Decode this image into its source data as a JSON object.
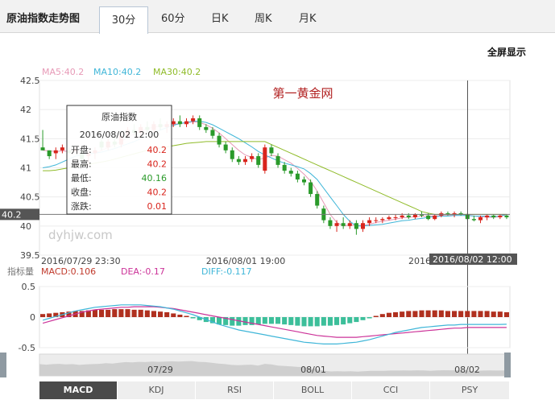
{
  "header": {
    "title": "原油指数走势图",
    "tabs": [
      {
        "label": "30分",
        "active": true
      },
      {
        "label": "60分",
        "active": false
      },
      {
        "label": "日K",
        "active": false
      },
      {
        "label": "周K",
        "active": false
      },
      {
        "label": "月K",
        "active": false
      }
    ],
    "fullscreen_label": "全屏显示"
  },
  "chart_data": {
    "type": "candlestick",
    "ma_legend": [
      {
        "name": "MA5:40.2",
        "color": "#e79ab7"
      },
      {
        "name": "MA10:40.2",
        "color": "#3fb6d8"
      },
      {
        "name": "MA30:40.2",
        "color": "#8fbb28"
      }
    ],
    "watermark_title": "第一黄金网",
    "watermark_site": "dyhjw.com",
    "ylim": [
      39.5,
      42.5
    ],
    "yticks": [
      "42.5",
      "42",
      "41.5",
      "41",
      "40.5",
      "40",
      "39.5"
    ],
    "ytick_values": [
      42.5,
      42,
      41.5,
      41,
      40.5,
      40,
      39.5
    ],
    "current_price": "40.2",
    "current_value": 40.2,
    "xtick_labels": [
      "2016/07/29 23:30",
      "2016/08/01 19:00",
      "2016/"
    ],
    "crosshair_label": "2016/08/02 12:00",
    "up_color": "#d9251d",
    "down_color": "#2a9a2a",
    "candles": [
      [
        41.35,
        41.65,
        41.3,
        41.3
      ],
      [
        41.3,
        41.3,
        41.15,
        41.2
      ],
      [
        41.25,
        41.35,
        41.15,
        41.3
      ],
      [
        41.3,
        41.4,
        41.25,
        41.35
      ],
      [
        41.3,
        41.35,
        41.25,
        41.25
      ],
      [
        41.3,
        41.35,
        41.25,
        41.3
      ],
      [
        41.25,
        41.3,
        41.1,
        41.15
      ],
      [
        41.2,
        41.3,
        41.0,
        41.25
      ],
      [
        41.25,
        41.35,
        41.15,
        41.3
      ],
      [
        41.45,
        41.5,
        41.3,
        41.35
      ],
      [
        41.35,
        41.5,
        41.3,
        41.45
      ],
      [
        41.45,
        41.55,
        41.35,
        41.4
      ],
      [
        41.4,
        41.6,
        41.35,
        41.55
      ],
      [
        41.55,
        41.7,
        41.5,
        41.65
      ],
      [
        41.65,
        41.75,
        41.55,
        41.6
      ],
      [
        41.6,
        41.75,
        41.55,
        41.7
      ],
      [
        41.7,
        41.8,
        41.6,
        41.65
      ],
      [
        41.65,
        41.8,
        41.6,
        41.75
      ],
      [
        41.75,
        41.85,
        41.65,
        41.7
      ],
      [
        41.7,
        41.8,
        41.6,
        41.75
      ],
      [
        41.75,
        41.85,
        41.7,
        41.8
      ],
      [
        41.8,
        41.9,
        41.7,
        41.75
      ],
      [
        41.75,
        41.85,
        41.7,
        41.8
      ],
      [
        41.8,
        41.9,
        41.75,
        41.85
      ],
      [
        41.85,
        41.9,
        41.65,
        41.7
      ],
      [
        41.7,
        41.75,
        41.6,
        41.65
      ],
      [
        41.65,
        41.7,
        41.5,
        41.55
      ],
      [
        41.55,
        41.6,
        41.35,
        41.4
      ],
      [
        41.4,
        41.45,
        41.25,
        41.3
      ],
      [
        41.3,
        41.35,
        41.1,
        41.15
      ],
      [
        41.15,
        41.2,
        41.05,
        41.1
      ],
      [
        41.1,
        41.2,
        41.05,
        41.15
      ],
      [
        41.15,
        41.25,
        41.1,
        41.2
      ],
      [
        41.2,
        41.25,
        41.0,
        41.05
      ],
      [
        40.95,
        41.4,
        40.9,
        41.35
      ],
      [
        41.35,
        41.4,
        41.2,
        41.25
      ],
      [
        41.2,
        41.25,
        41.0,
        41.05
      ],
      [
        41.05,
        41.1,
        40.9,
        40.95
      ],
      [
        40.95,
        41.0,
        40.85,
        40.9
      ],
      [
        40.9,
        40.95,
        40.75,
        40.8
      ],
      [
        40.8,
        40.85,
        40.7,
        40.75
      ],
      [
        40.75,
        40.8,
        40.5,
        40.55
      ],
      [
        40.55,
        40.6,
        40.3,
        40.35
      ],
      [
        40.3,
        40.35,
        40.05,
        40.1
      ],
      [
        40.1,
        40.15,
        39.95,
        40.0
      ],
      [
        40.0,
        40.1,
        39.9,
        40.05
      ],
      [
        40.05,
        40.15,
        39.95,
        40.0
      ],
      [
        40.0,
        40.1,
        39.95,
        40.05
      ],
      [
        40.05,
        40.1,
        39.85,
        39.95
      ],
      [
        39.95,
        40.1,
        39.9,
        40.05
      ],
      [
        40.05,
        40.15,
        40.0,
        40.1
      ],
      [
        40.1,
        40.15,
        40.05,
        40.1
      ],
      [
        40.1,
        40.15,
        40.05,
        40.12
      ],
      [
        40.12,
        40.18,
        40.1,
        40.15
      ],
      [
        40.15,
        40.2,
        40.1,
        40.15
      ],
      [
        40.15,
        40.22,
        40.12,
        40.18
      ],
      [
        40.18,
        40.22,
        40.12,
        40.15
      ],
      [
        40.15,
        40.22,
        40.12,
        40.2
      ],
      [
        40.2,
        40.25,
        40.15,
        40.18
      ],
      [
        40.18,
        40.22,
        40.1,
        40.12
      ],
      [
        40.12,
        40.2,
        40.1,
        40.18
      ],
      [
        40.18,
        40.25,
        40.15,
        40.22
      ],
      [
        40.22,
        40.25,
        40.18,
        40.2
      ],
      [
        40.2,
        40.25,
        40.15,
        40.22
      ],
      [
        40.22,
        40.25,
        40.18,
        40.2
      ],
      [
        40.2,
        40.22,
        40.1,
        40.12
      ],
      [
        40.12,
        40.18,
        40.08,
        40.1
      ],
      [
        40.1,
        40.18,
        40.05,
        40.15
      ],
      [
        40.15,
        40.2,
        40.1,
        40.18
      ],
      [
        40.18,
        40.2,
        40.12,
        40.15
      ],
      [
        40.15,
        40.2,
        40.12,
        40.18
      ],
      [
        40.18,
        40.2,
        40.12,
        40.15
      ]
    ],
    "ma5": [
      41.3,
      41.29,
      41.28,
      41.29,
      41.28,
      41.27,
      41.25,
      41.24,
      41.25,
      41.3,
      41.35,
      41.4,
      41.45,
      41.52,
      41.58,
      41.63,
      41.67,
      41.7,
      41.72,
      41.73,
      41.75,
      41.76,
      41.77,
      41.79,
      41.78,
      41.74,
      41.68,
      41.6,
      41.5,
      41.4,
      41.3,
      41.22,
      41.18,
      41.14,
      41.17,
      41.21,
      41.2,
      41.14,
      41.08,
      40.99,
      40.89,
      40.77,
      40.6,
      40.4,
      40.2,
      40.06,
      40.0,
      40.02,
      40.01,
      40.01,
      40.03,
      40.06,
      40.08,
      40.1,
      40.12,
      40.14,
      40.15,
      40.16,
      40.17,
      40.17,
      40.17,
      40.18,
      40.18,
      40.19,
      40.2,
      40.19,
      40.17,
      40.16,
      40.15,
      40.15,
      40.16,
      40.2
    ],
    "ma10": [
      41.0,
      41.02,
      41.05,
      41.1,
      41.15,
      41.2,
      41.22,
      41.24,
      41.25,
      41.27,
      41.3,
      41.33,
      41.37,
      41.41,
      41.45,
      41.5,
      41.55,
      41.6,
      41.65,
      41.69,
      41.73,
      41.76,
      41.78,
      41.8,
      41.8,
      41.78,
      41.74,
      41.68,
      41.62,
      41.56,
      41.5,
      41.43,
      41.36,
      41.28,
      41.22,
      41.17,
      41.12,
      41.08,
      41.05,
      41.02,
      40.98,
      40.9,
      40.8,
      40.65,
      40.5,
      40.35,
      40.2,
      40.08,
      40.0,
      40.0,
      40.01,
      40.02,
      40.03,
      40.05,
      40.07,
      40.09,
      40.1,
      40.12,
      40.13,
      40.15,
      40.16,
      40.17,
      40.17,
      40.18,
      40.18,
      40.18,
      40.17,
      40.17,
      40.17,
      40.16,
      40.17,
      40.2
    ],
    "ma30": [
      40.95,
      40.95,
      40.96,
      40.98,
      41.0,
      41.02,
      41.04,
      41.06,
      41.08,
      41.1,
      41.12,
      41.15,
      41.18,
      41.21,
      41.24,
      41.27,
      41.3,
      41.32,
      41.34,
      41.36,
      41.38,
      41.4,
      41.42,
      41.43,
      41.44,
      41.45,
      41.45,
      41.45,
      41.45,
      41.45,
      41.45,
      41.45,
      41.45,
      41.45,
      41.45,
      41.4,
      41.35,
      41.3,
      41.25,
      41.2,
      41.15,
      41.1,
      41.05,
      41.0,
      40.95,
      40.9,
      40.85,
      40.8,
      40.75,
      40.7,
      40.65,
      40.6,
      40.55,
      40.5,
      40.45,
      40.4,
      40.35,
      40.3,
      40.25,
      40.22,
      40.2,
      40.2,
      40.2,
      40.2,
      40.2,
      40.2,
      40.2,
      40.2,
      40.2,
      40.2,
      40.2,
      40.2
    ],
    "tooltip": {
      "title": "原油指数",
      "datetime": "2016/08/02 12:00",
      "rows": [
        {
          "label": "开盘:",
          "value": "40.2",
          "color": "#d9251d"
        },
        {
          "label": "最高:",
          "value": "40.2",
          "color": "#d9251d"
        },
        {
          "label": "最低:",
          "value": "40.16",
          "color": "#2a9a2a"
        },
        {
          "label": "收盘:",
          "value": "40.2",
          "color": "#d9251d"
        },
        {
          "label": "涨跌:",
          "value": "0.01",
          "color": "#d9251d"
        }
      ]
    },
    "indicator": {
      "label": "指标量",
      "legend": [
        {
          "name": "MACD:0.106",
          "color": "#c0392b"
        },
        {
          "name": "DEA:-0.17",
          "color": "#cc3399"
        },
        {
          "name": "DIFF:-0.117",
          "color": "#3fb6d8"
        }
      ],
      "ylim": [
        -0.5,
        0.5
      ],
      "yticks": [
        "0.5",
        "0",
        "-0.5"
      ],
      "ytick_values": [
        0.5,
        0,
        -0.5
      ],
      "hist": [
        0.05,
        0.06,
        0.07,
        0.08,
        0.09,
        0.1,
        0.1,
        0.11,
        0.12,
        0.12,
        0.12,
        0.13,
        0.13,
        0.13,
        0.12,
        0.12,
        0.11,
        0.1,
        0.09,
        0.08,
        0.06,
        0.04,
        0.02,
        -0.02,
        -0.05,
        -0.08,
        -0.1,
        -0.12,
        -0.13,
        -0.14,
        -0.14,
        -0.13,
        -0.13,
        -0.12,
        -0.11,
        -0.11,
        -0.11,
        -0.12,
        -0.13,
        -0.14,
        -0.15,
        -0.15,
        -0.15,
        -0.14,
        -0.14,
        -0.13,
        -0.12,
        -0.1,
        -0.08,
        -0.05,
        -0.02,
        0.02,
        0.05,
        0.07,
        0.08,
        0.09,
        0.1,
        0.1,
        0.11,
        0.11,
        0.11,
        0.11,
        0.1,
        0.1,
        0.1,
        0.1,
        0.1,
        0.1,
        0.1,
        0.09,
        0.09,
        0.08
      ],
      "dea": [
        -0.1,
        -0.07,
        -0.04,
        -0.01,
        0.02,
        0.05,
        0.08,
        0.1,
        0.12,
        0.13,
        0.14,
        0.15,
        0.16,
        0.16,
        0.17,
        0.17,
        0.17,
        0.17,
        0.16,
        0.15,
        0.14,
        0.12,
        0.1,
        0.08,
        0.06,
        0.04,
        0.02,
        0.0,
        -0.02,
        -0.04,
        -0.06,
        -0.08,
        -0.1,
        -0.12,
        -0.14,
        -0.16,
        -0.18,
        -0.2,
        -0.22,
        -0.24,
        -0.26,
        -0.28,
        -0.3,
        -0.31,
        -0.32,
        -0.33,
        -0.33,
        -0.33,
        -0.33,
        -0.32,
        -0.31,
        -0.3,
        -0.29,
        -0.28,
        -0.27,
        -0.26,
        -0.25,
        -0.24,
        -0.23,
        -0.22,
        -0.21,
        -0.2,
        -0.19,
        -0.18,
        -0.18,
        -0.17,
        -0.17,
        -0.17,
        -0.17,
        -0.17,
        -0.17,
        -0.17
      ],
      "diff": [
        -0.05,
        -0.02,
        0.01,
        0.04,
        0.07,
        0.1,
        0.12,
        0.14,
        0.16,
        0.17,
        0.18,
        0.19,
        0.2,
        0.2,
        0.2,
        0.2,
        0.19,
        0.18,
        0.17,
        0.15,
        0.13,
        0.1,
        0.07,
        0.04,
        0.0,
        -0.04,
        -0.08,
        -0.12,
        -0.15,
        -0.18,
        -0.21,
        -0.23,
        -0.25,
        -0.27,
        -0.29,
        -0.31,
        -0.33,
        -0.35,
        -0.37,
        -0.39,
        -0.41,
        -0.42,
        -0.43,
        -0.44,
        -0.44,
        -0.44,
        -0.43,
        -0.42,
        -0.41,
        -0.39,
        -0.37,
        -0.34,
        -0.31,
        -0.28,
        -0.25,
        -0.23,
        -0.21,
        -0.19,
        -0.17,
        -0.16,
        -0.15,
        -0.14,
        -0.13,
        -0.13,
        -0.12,
        -0.12,
        -0.12,
        -0.12,
        -0.12,
        -0.12,
        -0.12,
        -0.117
      ]
    },
    "navigator": {
      "labels": [
        "07/29",
        "08/01",
        "08/02"
      ],
      "window": [
        0.5,
        1.0
      ]
    }
  },
  "bottom_tabs": [
    {
      "label": "MACD",
      "active": true
    },
    {
      "label": "KDJ",
      "active": false
    },
    {
      "label": "RSI",
      "active": false
    },
    {
      "label": "BOLL",
      "active": false
    },
    {
      "label": "CCI",
      "active": false
    },
    {
      "label": "PSY",
      "active": false
    }
  ]
}
